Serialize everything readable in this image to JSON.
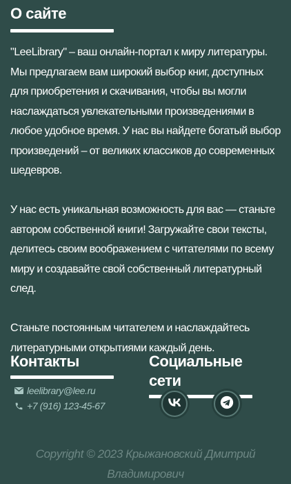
{
  "about": {
    "title": "О сайте",
    "paragraphs": [
      "\"LeeLibrary\" – ваш онлайн-портал к миру литературы. Мы предлагаем вам широкий выбор книг, доступных для приобретения и скачивания, чтобы вы могли наслаждаться увлекательными произведениями в любое удобное время. У нас вы найдете богатый выбор произведений – от великих классиков до современных шедевров.",
      "У нас есть уникальная возможность для вас — станьте автором собственной книги! Загружайте свои тексты, делитесь своим воображением с читателями по всему миру и создавайте свой собственный литературный след.",
      "Станьте постоянным читателем и наслаждайтесь литературными открытиями каждый день."
    ]
  },
  "contacts": {
    "title": "Контакты",
    "email": "leelibrary@lee.ru",
    "phone": "+7 (916) 123-45-67",
    "email_icon": "envelope-icon",
    "phone_icon": "phone-icon"
  },
  "social": {
    "title": "Социальные сети",
    "items": [
      {
        "icon": "vk-icon",
        "label": "VK"
      },
      {
        "icon": "telegram-icon",
        "label": "Telegram"
      }
    ]
  },
  "footer": {
    "line1": "Copyright © 2023 Крыжановский Дмитрий",
    "line2": "Владимирович"
  },
  "colors": {
    "background": "#2f4c49",
    "text": "#ffffff",
    "muted": "#a9c6c2",
    "footer": "#6d8784"
  }
}
